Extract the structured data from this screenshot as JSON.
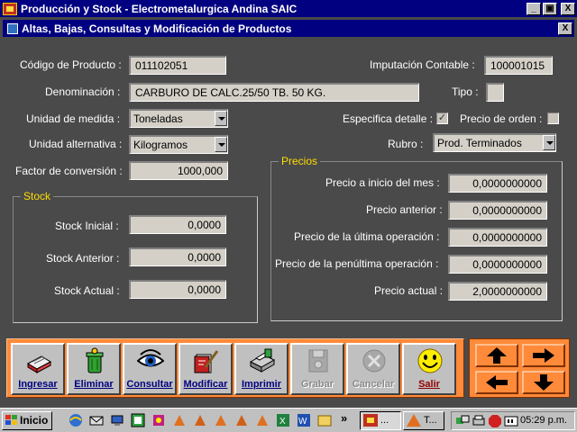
{
  "window": {
    "title": "Producción y Stock - Electrometalurgica Andina SAIC",
    "min_label": "_",
    "max_label": "▣",
    "close_label": "X"
  },
  "child": {
    "title": "Altas, Bajas, Consultas y Modificación de Productos",
    "close_label": "X"
  },
  "form": {
    "codigo_label": "Código de Producto :",
    "codigo_value": "011102051",
    "imputacion_label": "Imputación Contable :",
    "imputacion_value": "100001015",
    "denominacion_label": "Denominación :",
    "denominacion_value": "CARBURO DE CALC.25/50 TB. 50 KG.",
    "tipo_label": "Tipo :",
    "tipo_value": "",
    "unidad_medida_label": "Unidad de medida :",
    "unidad_medida_value": "Toneladas",
    "especifica_label": "Especifica detalle :",
    "especifica_checked": true,
    "precio_orden_label": "Precio de orden :",
    "precio_orden_checked": false,
    "unidad_alt_label": "Unidad alternativa :",
    "unidad_alt_value": "Kilogramos",
    "rubro_label": "Rubro :",
    "rubro_value": "Prod. Terminados",
    "factor_label": "Factor de conversión :",
    "factor_value": "1000,000"
  },
  "stock": {
    "title": "Stock",
    "inicial_label": "Stock Inicial :",
    "inicial_value": "0,0000",
    "anterior_label": "Stock Anterior :",
    "anterior_value": "0,0000",
    "actual_label": "Stock Actual :",
    "actual_value": "0,0000"
  },
  "precios": {
    "title": "Precios",
    "inicio_label": "Precio a inicio del mes :",
    "inicio_value": "0,0000000000",
    "anterior_label": "Precio anterior :",
    "anterior_value": "0,0000000000",
    "ultima_label": "Precio de la última operación :",
    "ultima_value": "0,0000000000",
    "penultima_label": "Precio de la penúltima operación :",
    "penultima_value": "0,0000000000",
    "actual_label": "Precio actual :",
    "actual_value": "2,0000000000"
  },
  "toolbar": {
    "ingresar": "Ingresar",
    "eliminar": "Eliminar",
    "consultar": "Consultar",
    "modificar": "Modificar",
    "imprimir": "Imprimir",
    "grabar": "Grabar",
    "cancelar": "Cancelar",
    "salir": "Salir"
  },
  "taskbar": {
    "start_label": "Inicio",
    "more_label": "»",
    "task1_label": "...",
    "task2_label": "T...",
    "clock": "05:29 p.m."
  },
  "colors": {
    "title_bar": "#000080",
    "form_bg": "#4a4a4a",
    "group_title": "#ffdd00",
    "toolbar_bg": "#ff8a3a"
  }
}
